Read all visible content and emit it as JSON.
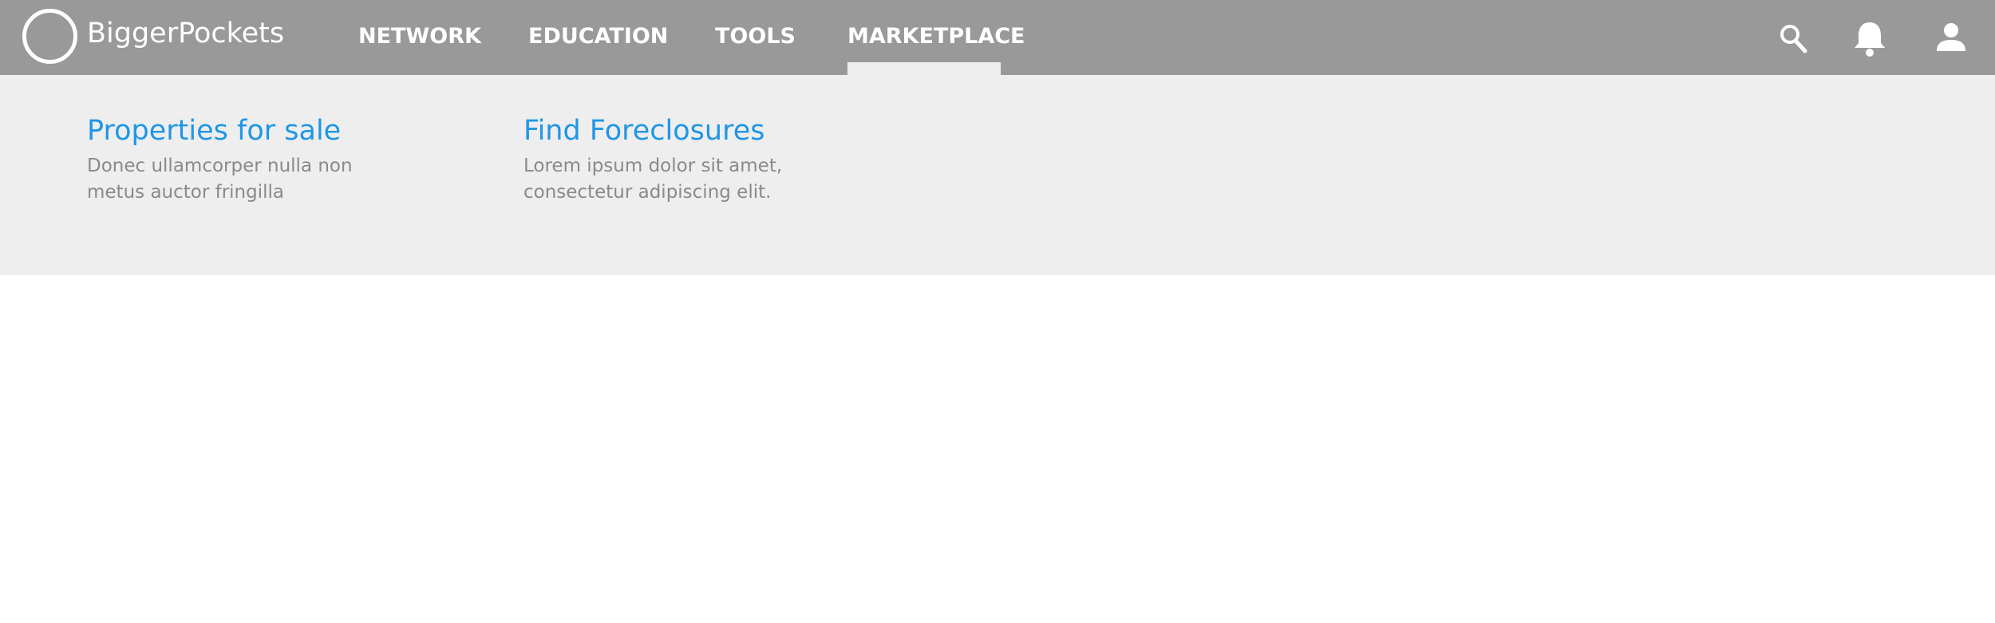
{
  "header": {
    "brand": "BiggerPockets",
    "nav": [
      {
        "label": "NETWORK"
      },
      {
        "label": "EDUCATION"
      },
      {
        "label": "TOOLS"
      },
      {
        "label": "MARKETPLACE"
      }
    ],
    "active_nav": "MARKETPLACE",
    "icons": [
      "search-icon",
      "bell-icon",
      "user-icon"
    ]
  },
  "marketplace_menu": {
    "items": [
      {
        "title": "Properties for sale",
        "description_line1": "Donec ullamcorper nulla non",
        "description_line2": "metus auctor fringilla"
      },
      {
        "title": "Find Foreclosures",
        "description_line1": "Lorem ipsum dolor sit amet,",
        "description_line2": "consectetur adipiscing elit."
      }
    ]
  },
  "colors": {
    "header_bg": "#999999",
    "dropdown_bg": "#eeeeee",
    "link": "#1f96e6",
    "muted_text": "#8a8a8a",
    "header_text": "#ffffff"
  }
}
